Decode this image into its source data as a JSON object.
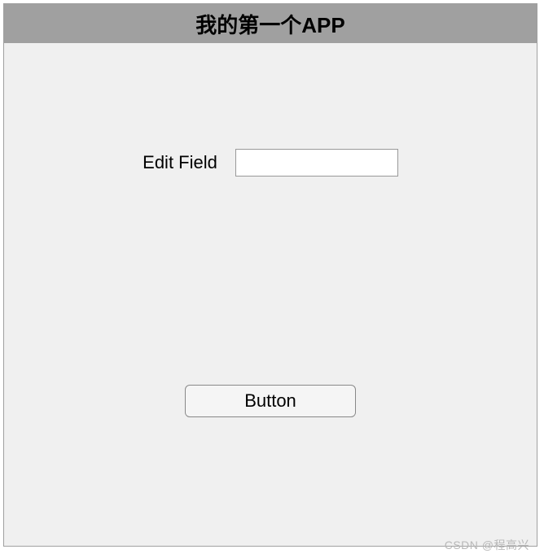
{
  "header": {
    "title": "我的第一个APP"
  },
  "form": {
    "edit_field": {
      "label": "Edit Field",
      "value": ""
    }
  },
  "actions": {
    "button_label": "Button"
  },
  "watermark": "CSDN @程高兴"
}
